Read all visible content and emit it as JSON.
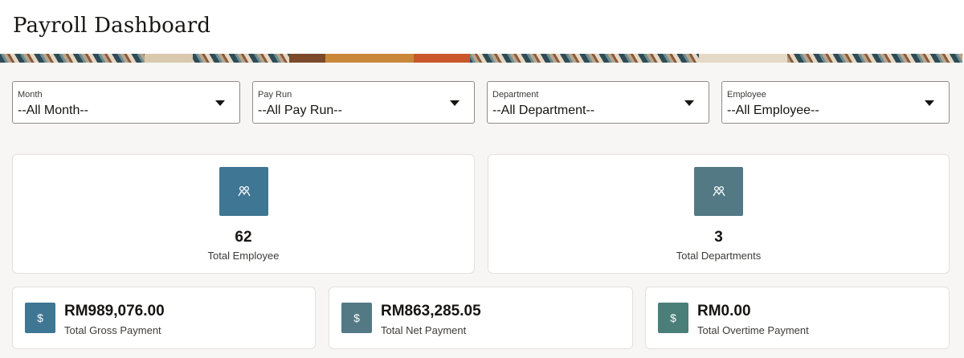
{
  "header": {
    "title": "Payroll Dashboard"
  },
  "filters": [
    {
      "label": "Month",
      "value": "--All Month--"
    },
    {
      "label": "Pay Run",
      "value": "--All Pay Run--"
    },
    {
      "label": "Department",
      "value": "--All Department--"
    },
    {
      "label": "Employee",
      "value": "--All Employee--"
    }
  ],
  "stats": {
    "employees": {
      "value": "62",
      "label": "Total Employee",
      "icon": "people-icon",
      "color": "#3f7694"
    },
    "departments": {
      "value": "3",
      "label": "Total Departments",
      "icon": "people-icon",
      "color": "#537985"
    }
  },
  "payments": [
    {
      "value": "RM989,076.00",
      "label": "Total Gross Payment",
      "icon": "dollar-icon",
      "icon_glyph": "$",
      "color": "#3f7694"
    },
    {
      "value": "RM863,285.05",
      "label": "Total Net Payment",
      "icon": "dollar-icon",
      "icon_glyph": "$",
      "color": "#537985"
    },
    {
      "value": "RM0.00",
      "label": "Total Overtime Payment",
      "icon": "dollar-icon",
      "icon_glyph": "$",
      "color": "#4a7e79"
    }
  ]
}
